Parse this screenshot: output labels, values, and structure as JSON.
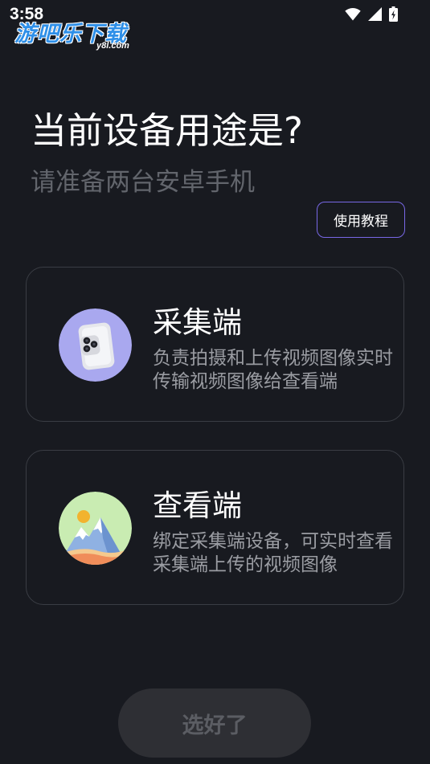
{
  "status_bar": {
    "time": "3:58",
    "icons": [
      "wifi-icon",
      "signal-icon",
      "battery-charging-icon"
    ]
  },
  "watermark": {
    "brand": "游吧乐下载",
    "domain": "y8l.com"
  },
  "header": {
    "title": "当前设备用途是?",
    "subtitle": "请准备两台安卓手机"
  },
  "tutorial_button": {
    "label": "使用教程",
    "border_color": "#7868e6"
  },
  "options": [
    {
      "title": "采集端",
      "desc_line1": "负责拍摄和上传视频图像实时",
      "desc_line2": "传输视频图像给查看端",
      "icon": "phone-camera-icon"
    },
    {
      "title": "查看端",
      "desc_line1": "绑定采集端设备，可实时查看",
      "desc_line2": "采集端上传的视频图像",
      "icon": "mountain-landscape-icon"
    }
  ],
  "confirm_button": {
    "label": "选好了",
    "state": "disabled"
  },
  "colors": {
    "background": "#181a20",
    "card_border": "#3a3d44",
    "accent": "#7868e6",
    "muted_text": "#62656c"
  }
}
